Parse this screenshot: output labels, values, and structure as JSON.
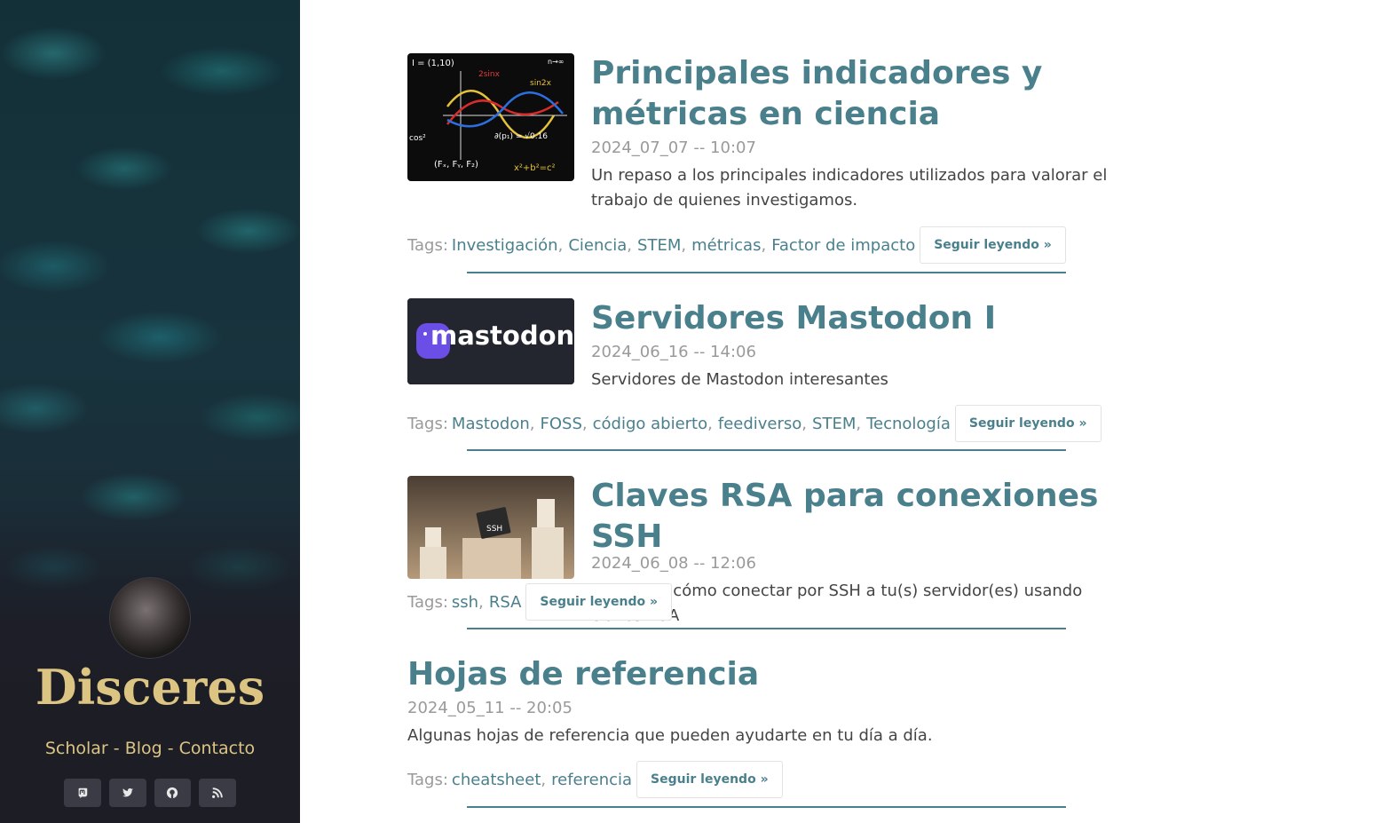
{
  "sidebar": {
    "site_title": "Disceres",
    "nav": [
      {
        "label": "Scholar"
      },
      {
        "label": "Blog"
      },
      {
        "label": "Contacto"
      }
    ],
    "nav_separator": " - ",
    "socials": [
      {
        "icon": "mastodon-icon"
      },
      {
        "icon": "twitter-icon"
      },
      {
        "icon": "github-icon"
      },
      {
        "icon": "rss-icon"
      }
    ]
  },
  "posts": [
    {
      "title": "Principales indicadores y métricas en ciencia",
      "date": "2024_07_07 -- 10:07",
      "summary": "Un repaso a los principales indicadores utilizados para valorar el trabajo de quienes investigamos.",
      "tags_label": "Tags:",
      "tags": [
        "Investigación",
        "Ciencia",
        "STEM",
        "métricas",
        "Factor de impacto"
      ],
      "read_more": "Seguir leyendo »",
      "thumbnail": "math-chalkboard-image",
      "thumb_text": [
        "I = (1,10)",
        "n→∞",
        "2sinx",
        "sin2x",
        "∂(p₁) = √0.16",
        "x²+b²=c²",
        "cos²",
        "(Fₓ, Fᵧ, F₂)"
      ]
    },
    {
      "title": "Servidores Mastodon I",
      "date": "2024_06_16 -- 14:06",
      "summary": "Servidores de Mastodon interesantes",
      "tags_label": "Tags:",
      "tags": [
        "Mastodon",
        "FOSS",
        "código abierto",
        "feediverso",
        "STEM",
        "Tecnología"
      ],
      "read_more": "Seguir leyendo »",
      "thumbnail": "mastodon-logo-image",
      "thumb_text": [
        "mastodon"
      ]
    },
    {
      "title": "Claves RSA para conexiones SSH",
      "date": "2024_06_08 -- 12:06",
      "summary": "Te cuento cómo conectar por SSH a tu(s) servidor(es) usando claves RSA",
      "tags_label": "Tags:",
      "tags": [
        "ssh",
        "RSA"
      ],
      "read_more": "Seguir leyendo »",
      "thumbnail": "ssh-servers-image",
      "thumb_text": [
        "SSH"
      ]
    },
    {
      "title": "Hojas de referencia",
      "date": "2024_05_11 -- 20:05",
      "summary": "Algunas hojas de referencia que pueden ayudarte en tu día a día.",
      "tags_label": "Tags:",
      "tags": [
        "cheatsheet",
        "referencia"
      ],
      "read_more": "Seguir leyendo »",
      "thumbnail": null
    }
  ],
  "colors": {
    "accent": "#4a7f8c",
    "sidebar_title": "#dcc583",
    "muted": "#9a9a9a",
    "text": "#444444"
  }
}
